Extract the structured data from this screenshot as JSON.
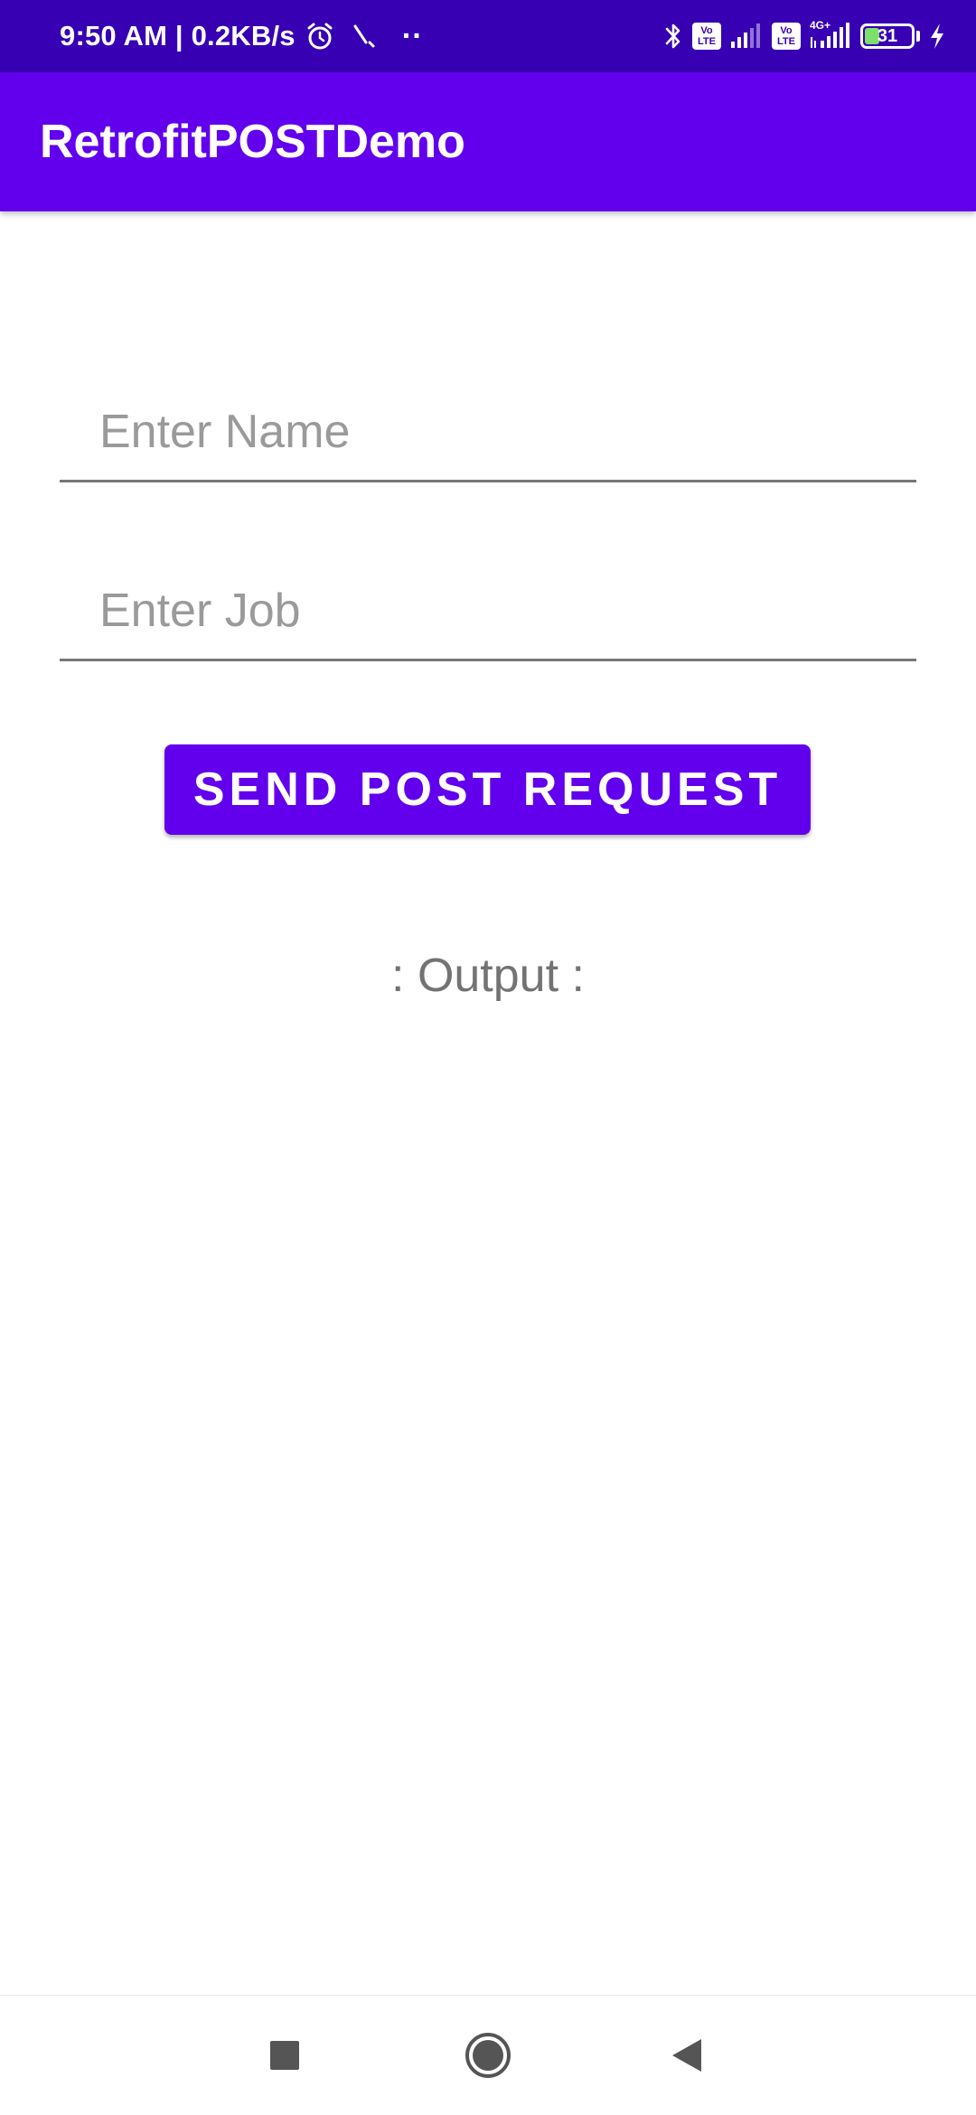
{
  "status_bar": {
    "time_speed": "9:50 AM | 0.2KB/s",
    "overflow_dots": "··",
    "lte1": [
      "Vo",
      "LTE"
    ],
    "lte2": [
      "Vo",
      "LTE"
    ],
    "network_type": "4G+",
    "battery_level": "31",
    "battery_percent": 31,
    "icons": [
      "alarm-icon",
      "missed-call-icon",
      "bluetooth-icon",
      "signal-icon",
      "battery-icon",
      "charging-icon"
    ]
  },
  "app_bar": {
    "title": "RetrofitPOSTDemo"
  },
  "form": {
    "name_placeholder": "Enter Name",
    "name_value": "",
    "job_placeholder": "Enter Job",
    "job_value": "",
    "send_label": "SEND POST REQUEST"
  },
  "output": {
    "text": ": Output :"
  },
  "nav_bar": {
    "icons": [
      "recents-icon",
      "home-icon",
      "back-icon"
    ]
  },
  "colors": {
    "status_bar": "#3700B3",
    "primary": "#6200EE",
    "underline": "#777777",
    "placeholder": "#9a9a9a",
    "output_text": "#737373",
    "nav_icon": "#555555"
  }
}
